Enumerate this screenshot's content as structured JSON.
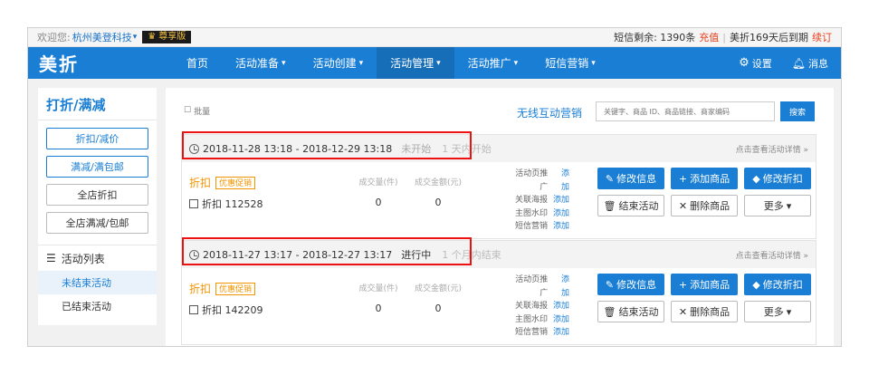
{
  "topbar": {
    "welcome": "欢迎您:",
    "shop": "杭州美登科技",
    "vip": "尊享版",
    "sms_remaining": "短信剩余: 1390条",
    "recharge": "充值",
    "expire": "美折169天后到期",
    "renew": "续订"
  },
  "nav": {
    "logo": "美折",
    "menu": [
      {
        "label": "首页"
      },
      {
        "label": "活动准备"
      },
      {
        "label": "活动创建"
      },
      {
        "label": "活动管理"
      },
      {
        "label": "活动推广"
      },
      {
        "label": "短信营销"
      }
    ],
    "settings": "设置",
    "messages": "消息"
  },
  "sidebar": {
    "title": "打折/满减",
    "buttons": [
      "折扣/减价",
      "满减/满包邮",
      "全店折扣",
      "全店满减/包邮"
    ],
    "list_title": "活动列表",
    "items": [
      "未结束活动",
      "已结束活动"
    ]
  },
  "toolbar": {
    "batch": "批量",
    "wireless": "无线互动营销",
    "search_placeholder": "关键字、商品 ID、商品链接、商家编码",
    "search_button": "搜索"
  },
  "cards": [
    {
      "time": "2018-11-28 13:18 - 2018-12-29 13:18",
      "status": "未开始",
      "hint": "1 天内开始",
      "detail": "点击查看活动详情 »",
      "type": "折扣",
      "badge": "优惠促销",
      "id": "折扣 112528",
      "qty_label": "成交量(件)",
      "qty": "0",
      "amount_label": "成交金额(元)",
      "amount": "0",
      "links": [
        {
          "label": "活动页推广",
          "action": "添加"
        },
        {
          "label": "关联海报",
          "action": "添加"
        },
        {
          "label": "主图水印",
          "action": "添加"
        },
        {
          "label": "短信营销",
          "action": "添加"
        }
      ],
      "actions": [
        "修改信息",
        "添加商品",
        "修改折扣",
        "结束活动",
        "删除商品",
        "更多"
      ]
    },
    {
      "time": "2018-11-27 13:17 - 2018-12-27 13:17",
      "status": "进行中",
      "hint": "1 个月内结束",
      "detail": "点击查看活动详情 »",
      "type": "折扣",
      "badge": "优惠促销",
      "id": "折扣 142209",
      "qty_label": "成交量(件)",
      "qty": "0",
      "amount_label": "成交金额(元)",
      "amount": "0",
      "links": [
        {
          "label": "活动页推广",
          "action": "添加"
        },
        {
          "label": "关联海报",
          "action": "添加"
        },
        {
          "label": "主图水印",
          "action": "添加"
        },
        {
          "label": "短信营销",
          "action": "添加"
        }
      ],
      "actions": [
        "修改信息",
        "添加商品",
        "修改折扣",
        "结束活动",
        "删除商品",
        "更多"
      ]
    }
  ]
}
